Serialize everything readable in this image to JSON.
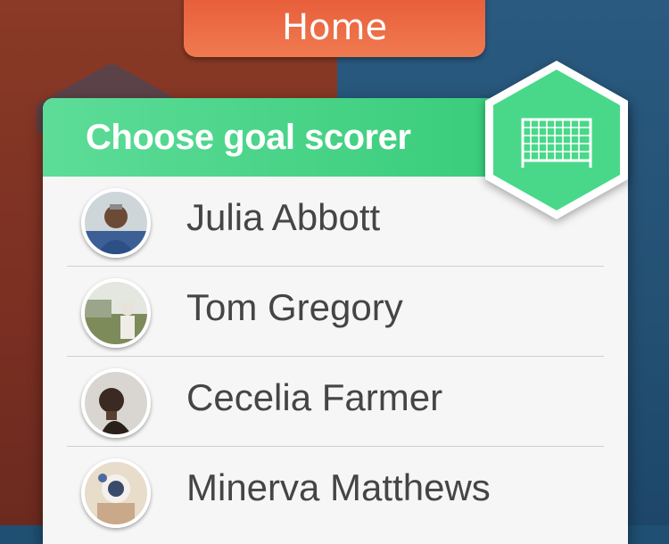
{
  "header": {
    "home_label": "Home"
  },
  "panel": {
    "title": "Choose goal scorer",
    "badge_icon": "goal-net-icon"
  },
  "players": [
    {
      "name": "Julia Abbott",
      "avatar_color": "#4a6aa0"
    },
    {
      "name": "Tom Gregory",
      "avatar_color": "#8e9a6e"
    },
    {
      "name": "Cecelia Farmer",
      "avatar_color": "#c9c6c2"
    },
    {
      "name": "Minerva Matthews",
      "avatar_color": "#d8c7a8"
    }
  ],
  "colors": {
    "accent_green": "#2fc872",
    "home_orange": "#e65c38",
    "text": "#454545"
  }
}
